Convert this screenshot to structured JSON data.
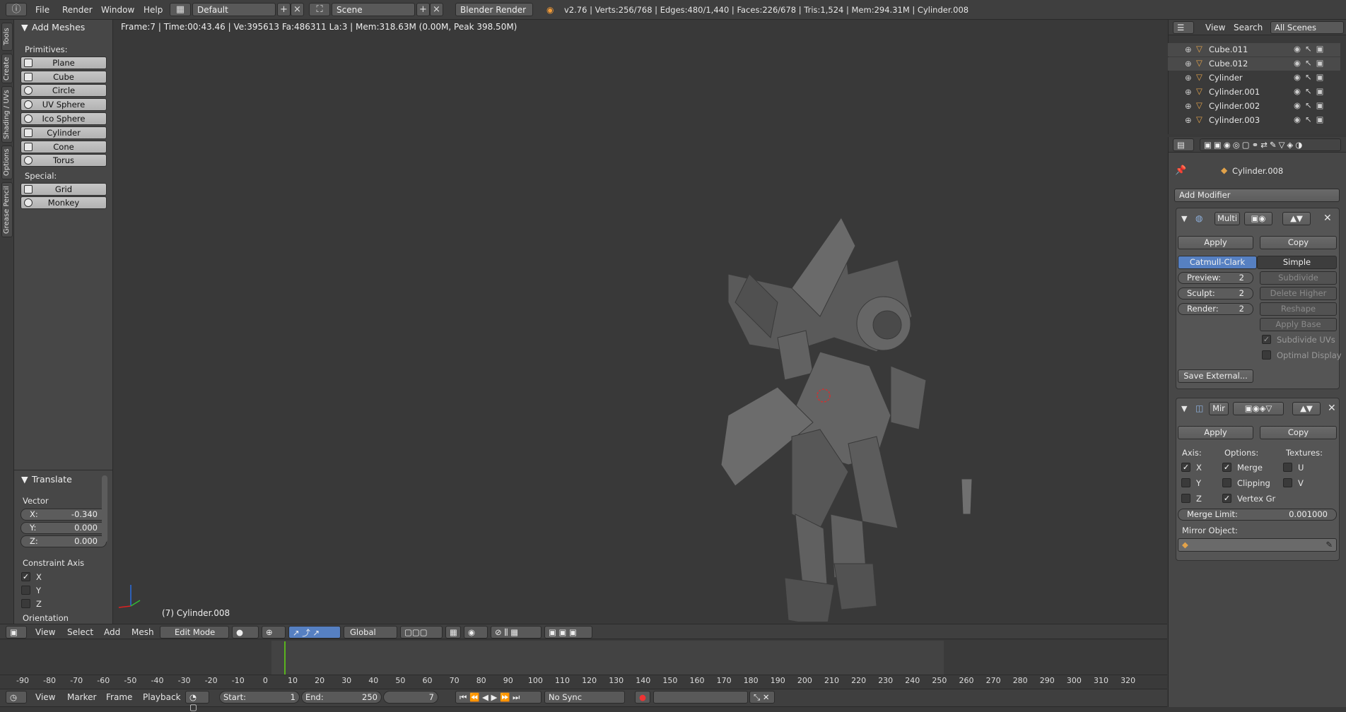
{
  "topbar": {
    "menus": [
      "File",
      "Render",
      "Window",
      "Help"
    ],
    "screen_layout": "Default",
    "scene": "Scene",
    "engine": "Blender Render",
    "stats": "v2.76 | Verts:256/768 | Edges:480/1,440 | Faces:226/678 | Tris:1,524 | Mem:294.31M | Cylinder.008"
  },
  "vtabs": [
    "Tools",
    "Create",
    "Shading / UVs",
    "Options",
    "Grease Pencil"
  ],
  "add_meshes": {
    "title": "Add Meshes",
    "primitives_label": "Primitives:",
    "primitives": [
      "Plane",
      "Cube",
      "Circle",
      "UV Sphere",
      "Ico Sphere",
      "Cylinder",
      "Cone",
      "Torus"
    ],
    "special_label": "Special:",
    "special": [
      "Grid",
      "Monkey"
    ]
  },
  "translate": {
    "title": "Translate",
    "vector_label": "Vector",
    "x_label": "X:",
    "x": "-0.340",
    "y_label": "Y:",
    "y": "0.000",
    "z_label": "Z:",
    "z": "0.000",
    "constraint_label": "Constraint Axis",
    "constraints": [
      "X",
      "Y",
      "Z"
    ],
    "orientation_label": "Orientation"
  },
  "viewport": {
    "info": "Frame:7 | Time:00:43.46 | Ve:395613 Fa:486311 La:3 | Mem:318.63M (0.00M, Peak 398.50M)",
    "object_label": "(7) Cylinder.008"
  },
  "view3d_header": {
    "menus": [
      "View",
      "Select",
      "Add",
      "Mesh"
    ],
    "mode": "Edit Mode",
    "orientation": "Global"
  },
  "timeline": {
    "ticks": [
      "-90",
      "-80",
      "-70",
      "-60",
      "-50",
      "-40",
      "-30",
      "-20",
      "-10",
      "0",
      "10",
      "20",
      "30",
      "40",
      "50",
      "60",
      "70",
      "80",
      "90",
      "100",
      "110",
      "120",
      "130",
      "140",
      "150",
      "160",
      "170",
      "180",
      "190",
      "200",
      "210",
      "220",
      "230",
      "240",
      "250",
      "260",
      "270",
      "280",
      "290",
      "300",
      "310",
      "320"
    ],
    "menus": [
      "View",
      "Marker",
      "Frame",
      "Playback"
    ],
    "start_label": "Start:",
    "start": "1",
    "end_label": "End:",
    "end": "250",
    "current": "7",
    "sync": "No Sync"
  },
  "outliner": {
    "menus": [
      "View",
      "Search"
    ],
    "filter": "All Scenes",
    "items": [
      "Cube.011",
      "Cube.012",
      "Cylinder",
      "Cylinder.001",
      "Cylinder.002",
      "Cylinder.003"
    ]
  },
  "properties": {
    "object_name": "Cylinder.008",
    "add_modifier": "Add Modifier",
    "multires": {
      "name": "Multi",
      "apply": "Apply",
      "copy": "Copy",
      "catmull": "Catmull-Clark",
      "simple": "Simple",
      "preview_label": "Preview:",
      "preview": "2",
      "sculpt_label": "Sculpt:",
      "sculpt": "2",
      "render_label": "Render:",
      "render": "2",
      "subdivide": "Subdivide",
      "delete_higher": "Delete Higher",
      "reshape": "Reshape",
      "apply_base": "Apply Base",
      "subdivide_uvs": "Subdivide UVs",
      "optimal_display": "Optimal Display",
      "save_external": "Save External..."
    },
    "mirror": {
      "name": "Mir",
      "apply": "Apply",
      "copy": "Copy",
      "axis_label": "Axis:",
      "options_label": "Options:",
      "textures_label": "Textures:",
      "axes": [
        "X",
        "Y",
        "Z"
      ],
      "options": [
        "Merge",
        "Clipping",
        "Vertex Gr"
      ],
      "textures": [
        "U",
        "V"
      ],
      "merge_limit_label": "Merge Limit:",
      "merge_limit": "0.001000",
      "mirror_object_label": "Mirror Object:"
    }
  },
  "colors": {
    "accent": "#5680c2",
    "timeline_current": "#5ab31e"
  }
}
